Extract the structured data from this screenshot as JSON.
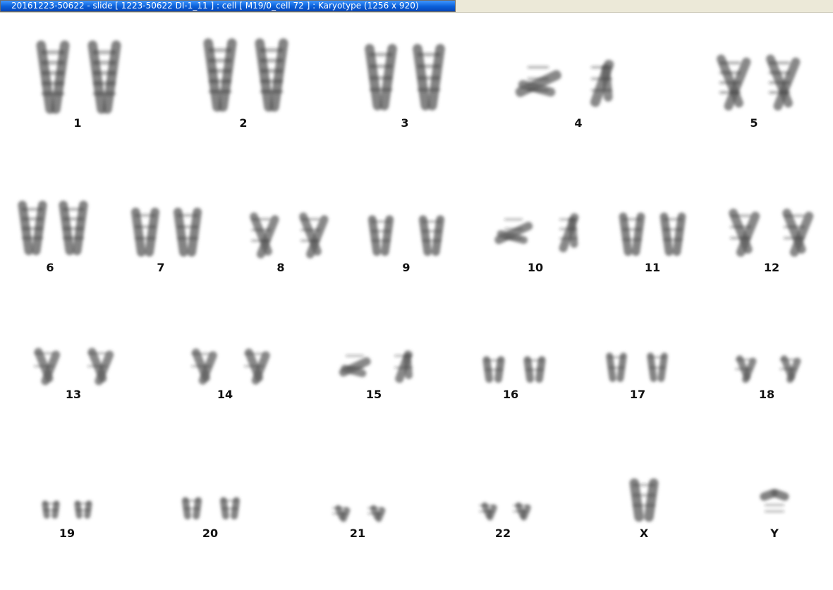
{
  "window": {
    "title": "20161223-50622 - slide [ 1223-50622 DI-1_11 ] : cell [ M19/0_cell 72 ] : Karyotype  (1256 x 920)"
  },
  "karyotype": {
    "chromosomes": [
      {
        "id": "1",
        "label": "1"
      },
      {
        "id": "2",
        "label": "2"
      },
      {
        "id": "3",
        "label": "3"
      },
      {
        "id": "4",
        "label": "4"
      },
      {
        "id": "5",
        "label": "5"
      },
      {
        "id": "6",
        "label": "6"
      },
      {
        "id": "7",
        "label": "7"
      },
      {
        "id": "8",
        "label": "8"
      },
      {
        "id": "9",
        "label": "9"
      },
      {
        "id": "10",
        "label": "10"
      },
      {
        "id": "11",
        "label": "11"
      },
      {
        "id": "12",
        "label": "12"
      },
      {
        "id": "13",
        "label": "13"
      },
      {
        "id": "14",
        "label": "14"
      },
      {
        "id": "15",
        "label": "15"
      },
      {
        "id": "16",
        "label": "16"
      },
      {
        "id": "17",
        "label": "17"
      },
      {
        "id": "18",
        "label": "18"
      },
      {
        "id": "19",
        "label": "19"
      },
      {
        "id": "20",
        "label": "20"
      },
      {
        "id": "21",
        "label": "21"
      },
      {
        "id": "22",
        "label": "22"
      },
      {
        "id": "X",
        "label": "X"
      },
      {
        "id": "Y",
        "label": "Y"
      }
    ]
  },
  "colors": {
    "chromatin": "#5a5a5a",
    "band": "#2b2b2b",
    "title_bar": "#0a5fd8"
  }
}
